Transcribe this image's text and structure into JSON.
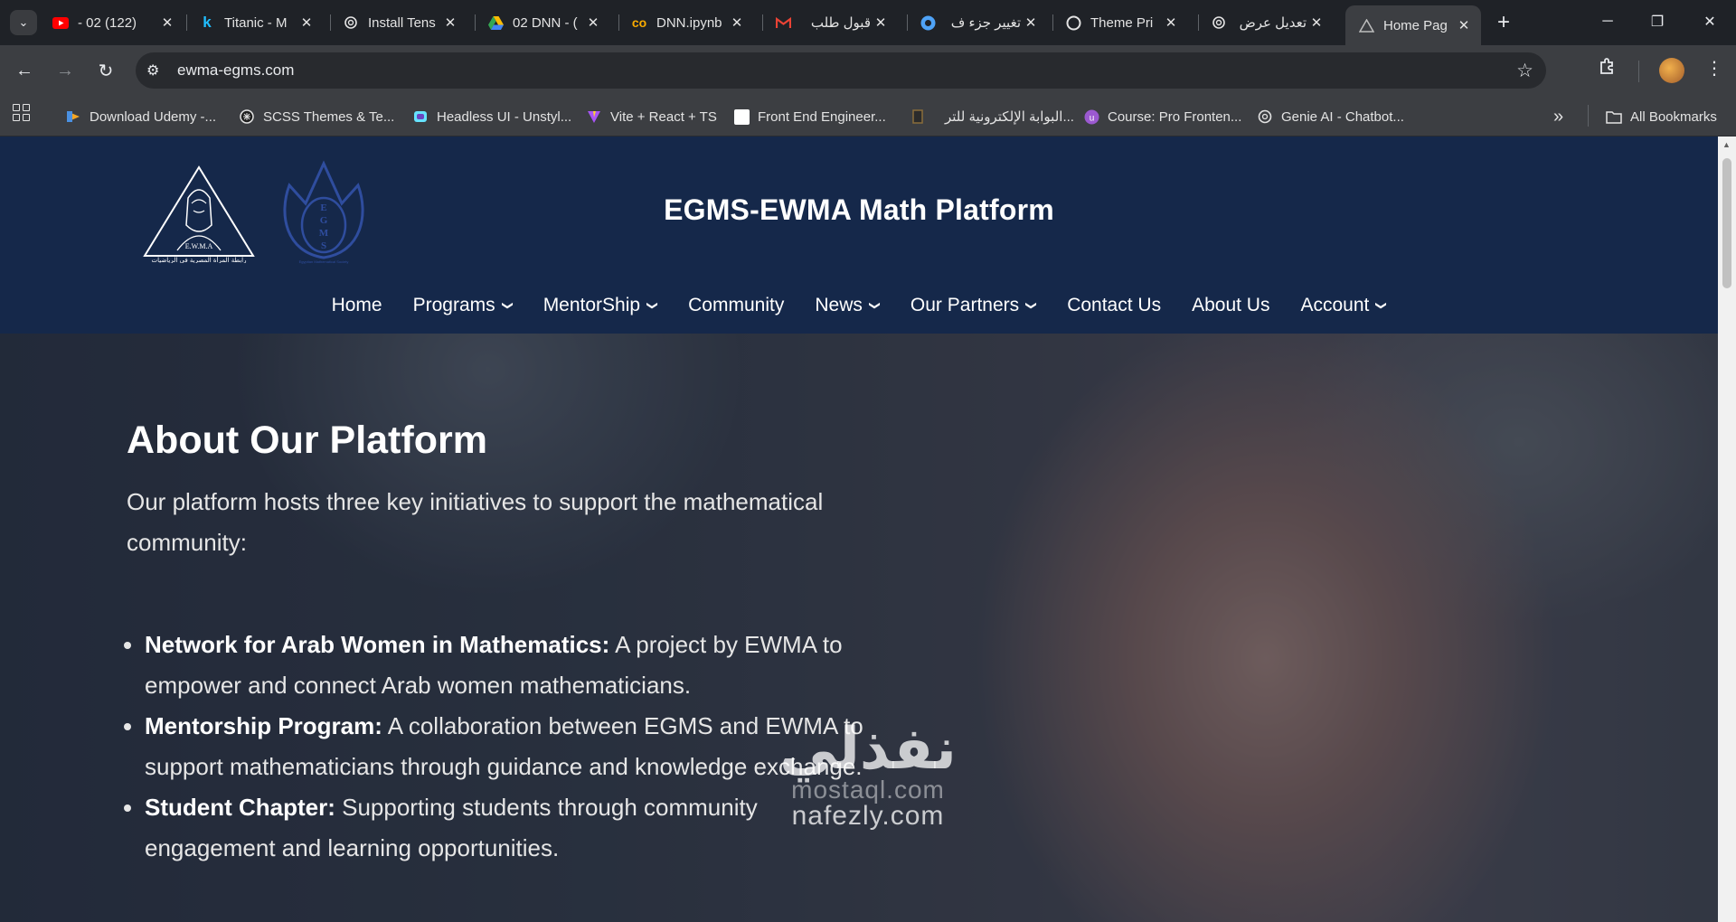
{
  "browser": {
    "tabs": [
      {
        "title": "- 02 (122)",
        "icon": "youtube-icon",
        "icon_color": "#ff0000",
        "active": false
      },
      {
        "title": "Titanic - M",
        "icon": "kaggle-icon",
        "icon_color": "#20beff",
        "active": false
      },
      {
        "title": "Install Tens",
        "icon": "openai-icon",
        "icon_color": "#e3e3e3",
        "active": false
      },
      {
        "title": "02 DNN - (",
        "icon": "google-drive-icon",
        "icon_color": "#fbbc04",
        "active": false
      },
      {
        "title": "DNN.ipynb",
        "icon": "colab-icon",
        "icon_color": "#f9ab00",
        "active": false
      },
      {
        "title": "قبول طلب",
        "icon": "gmail-icon",
        "icon_color": "#ea4335",
        "active": false
      },
      {
        "title": "تغيير جزء ف",
        "icon": "circle-app-icon",
        "icon_color": "#4fa3f7",
        "active": false
      },
      {
        "title": "Theme Pri",
        "icon": "github-icon",
        "icon_color": "#e3e3e3",
        "active": false
      },
      {
        "title": "تعديل عرض",
        "icon": "openai-icon",
        "icon_color": "#e3e3e3",
        "active": false
      },
      {
        "title": "Home Pag",
        "icon": "site-triangle-icon",
        "icon_color": "#bdbdbd",
        "active": true
      }
    ],
    "new_tab_symbol": "+",
    "window_controls": {
      "minimize": "─",
      "restore": "❐",
      "close": "✕"
    },
    "address": {
      "url": "ewma-egms.com"
    },
    "bookmarks": [
      {
        "label": "Download Udemy -...",
        "icon": "udemy-bookmark-icon",
        "icon_color": "#f5a623"
      },
      {
        "label": "SCSS Themes & Te...",
        "icon": "scss-bookmark-icon",
        "icon_color": "#e3e3e3"
      },
      {
        "label": "Headless UI - Unstyl...",
        "icon": "headlessui-bookmark-icon",
        "icon_color": "#66e3ff"
      },
      {
        "label": "Vite + React + TS",
        "icon": "vite-bookmark-icon",
        "icon_color": "#a855f7"
      },
      {
        "label": "Front End Engineer...",
        "icon": "page-bookmark-icon",
        "icon_color": "#ffffff"
      },
      {
        "label": "البوابة الإلكترونية للتر...",
        "icon": "portal-bookmark-icon",
        "icon_color": "#8a6d3b"
      },
      {
        "label": "Course: Pro Fronten...",
        "icon": "course-bookmark-icon",
        "icon_color": "#9b59d0"
      },
      {
        "label": "Genie AI - Chatbot...",
        "icon": "genie-bookmark-icon",
        "icon_color": "#e3e3e3"
      }
    ],
    "more_bookmarks_symbol": "»",
    "all_bookmarks_label": "All Bookmarks"
  },
  "site": {
    "brand_color": "#15284a",
    "title": "EGMS-EWMA Math Platform",
    "logos": {
      "ewma": {
        "text_top": "E.W.M.A",
        "text_bottom": "رابطة المرأة المصرية في الرياضيات"
      },
      "egms": {
        "letters": "EGMS",
        "ring_text": "Egyptian Mathematical Society"
      }
    },
    "nav": [
      {
        "label": "Home",
        "dropdown": false
      },
      {
        "label": "Programs",
        "dropdown": true
      },
      {
        "label": "MentorShip",
        "dropdown": true
      },
      {
        "label": "Community",
        "dropdown": false
      },
      {
        "label": "News",
        "dropdown": true
      },
      {
        "label": "Our Partners",
        "dropdown": true
      },
      {
        "label": "Contact Us",
        "dropdown": false
      },
      {
        "label": "About Us",
        "dropdown": false
      },
      {
        "label": "Account",
        "dropdown": true
      }
    ],
    "hero": {
      "heading": "About Our Platform",
      "intro": "Our platform hosts three key initiatives to support the mathematical community:",
      "items": [
        {
          "bold": "Network for Arab Women in Mathematics:",
          "text": " A project by EWMA to empower and connect Arab women mathematicians."
        },
        {
          "bold": "Mentorship Program:",
          "text": " A collaboration between EGMS and EWMA to support mathematicians through guidance and knowledge exchange."
        },
        {
          "bold": "Student Chapter:",
          "text": " Supporting students through community engagement and learning opportunities."
        }
      ]
    },
    "watermark": {
      "arabic": "نفذلي",
      "line1": "mostaql.com",
      "line2": "nafezly.com"
    }
  }
}
